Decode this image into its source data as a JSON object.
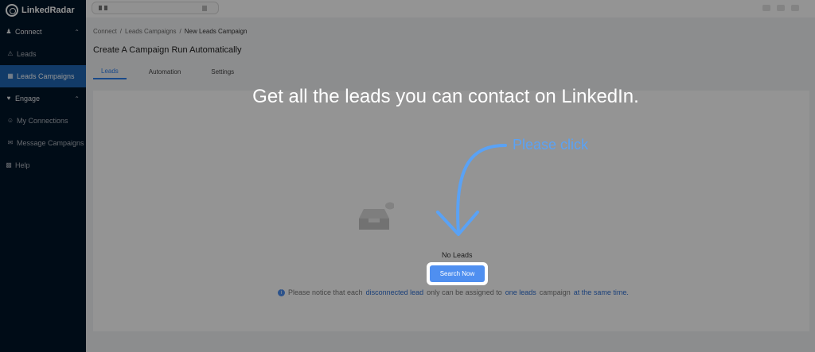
{
  "app": {
    "name": "LinkedRadar"
  },
  "sidebar": {
    "groups": [
      {
        "label": "Connect",
        "items": [
          {
            "label": "Leads"
          },
          {
            "label": "Leads Campaigns",
            "active": true
          }
        ]
      },
      {
        "label": "Engage",
        "items": [
          {
            "label": "My Connections"
          },
          {
            "label": "Message Campaigns"
          }
        ]
      }
    ],
    "help": {
      "label": "Help"
    }
  },
  "breadcrumb": {
    "items": [
      "Connect",
      "Leads Campaigns",
      "New Leads Campaign"
    ],
    "separator": "/"
  },
  "page": {
    "title": "Create A Campaign Run Automatically",
    "tabs": [
      {
        "label": "Leads",
        "active": true
      },
      {
        "label": "Automation"
      },
      {
        "label": "Settings"
      }
    ]
  },
  "empty_state": {
    "label": "No Leads",
    "button_label": "Search Now"
  },
  "notice": {
    "part1": "Please notice that each",
    "link1": "disconnected lead",
    "part2": "only can be assigned to",
    "link2": "one leads",
    "part3": "campaign",
    "link3": "at the same time."
  },
  "overlay": {
    "title": "Get all the leads you can contact on LinkedIn.",
    "hint": "Please click"
  },
  "colors": {
    "accent": "#4f8ff0",
    "sidebar": "#001529",
    "active": "#1f66b3",
    "hint": "#5aa2f5"
  }
}
